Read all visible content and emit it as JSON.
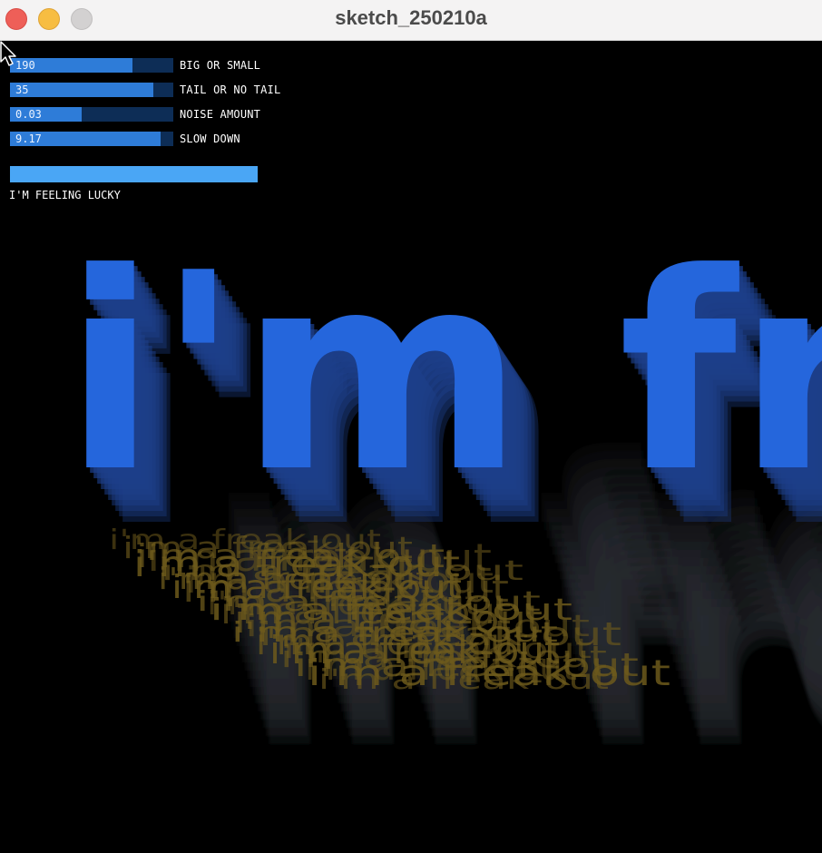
{
  "window": {
    "title": "sketch_250210a"
  },
  "controls": {
    "sliders": [
      {
        "value_text": "190",
        "label": "BIG OR SMALL",
        "fill": 0.75
      },
      {
        "value_text": "35",
        "label": "TAIL OR NO TAIL",
        "fill": 0.88
      },
      {
        "value_text": "0.03",
        "label": "NOISE AMOUNT",
        "fill": 0.44
      },
      {
        "value_text": "9.17",
        "label": "SLOW DOWN",
        "fill": 0.92
      }
    ],
    "lucky_button": {
      "label": "I'M FEELING LUCKY"
    }
  },
  "artwork": {
    "main_text": "i'm fre",
    "shadow_text": "m frea",
    "scribble_text": "i'm a freak-out",
    "colors": {
      "main": "#2566dc",
      "trail": "#1d3f8a",
      "shadow": "#2a2d33",
      "scribble": "#6d5a1c",
      "slider_track": "#0d2d56",
      "slider_fill": "#2e7cd8",
      "button": "#4aa6f5"
    }
  }
}
